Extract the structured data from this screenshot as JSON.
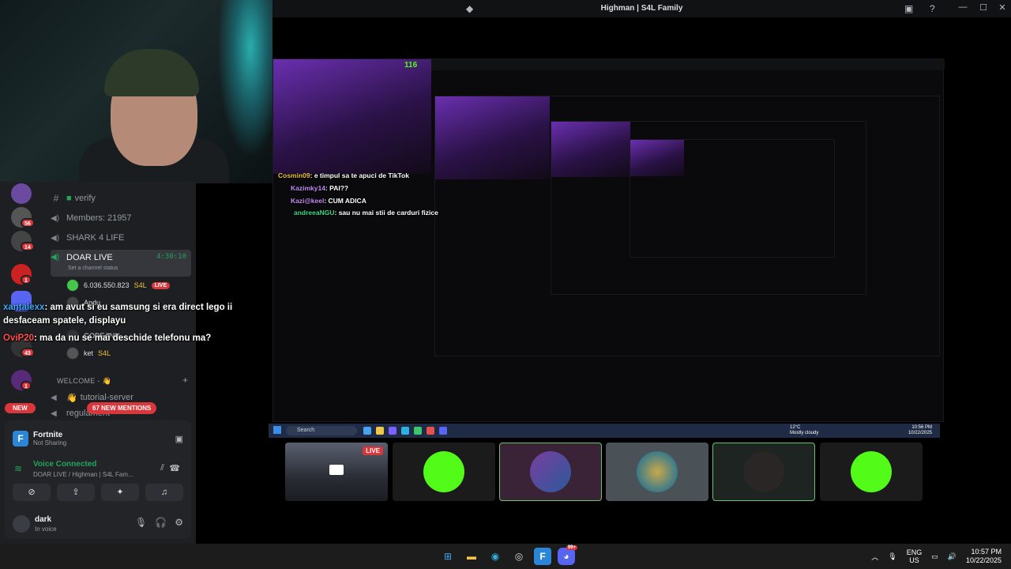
{
  "window": {
    "title": "Highman | S4L Family"
  },
  "discord": {
    "servers": [
      {
        "badge": ""
      },
      {
        "badge": "56"
      },
      {
        "badge": "14"
      },
      {
        "badge": "1"
      },
      {
        "badge": ""
      },
      {
        "badge": "43"
      },
      {
        "badge": "1"
      }
    ],
    "channels": {
      "verify": "verify",
      "members": "Members: 21957",
      "shark": "SHARK 4 LIFE",
      "doar_live": "DOAR LIVE",
      "doar_live_timer": "4:30:10",
      "set_status": "Set a channel status",
      "tutorial": "tutorial-server",
      "regulament": "regulament"
    },
    "voice_members": [
      {
        "name": "6.036.550.823",
        "tag": "S4L",
        "live": "LIVE"
      },
      {
        "name": "Andu",
        "tag": "",
        "live": ""
      },
      {
        "name": "GODEANU",
        "tag": "",
        "live": ""
      },
      {
        "name": "ket",
        "tag": "S4L",
        "live": ""
      }
    ],
    "category_welcome": "WELCOME - 👋",
    "new_pill": "NEW",
    "mentions_pill": "67 NEW MENTIONS",
    "activity": {
      "title": "Fortnite",
      "subtitle": "Not Sharing"
    },
    "voice": {
      "status": "Voice Connected",
      "channel": "DOAR LIVE / Highman | S4L Fam..."
    },
    "user": {
      "name": "dark",
      "status": "In voice"
    }
  },
  "chat": [
    {
      "user": "xantalexx",
      "text": "am avut si eu samsung si era direct lego ii"
    },
    {
      "user": "",
      "text": "desfaceam spatele, displayu"
    },
    {
      "user": "OviP20",
      "text": "ma da nu se mai deschide telefonu ma?"
    }
  ],
  "inner_stream": {
    "kick_count": "116",
    "chat": [
      {
        "user": "Cosmin09",
        "text": "e timpul sa te apuci de TikTok"
      },
      {
        "user": "Kazimky14",
        "text": "PAI??"
      },
      {
        "user": "Kazi@keel",
        "text": "CUM ADICA"
      },
      {
        "user": "andreeaNGU",
        "text": "sau nu mai stii de carduri fizice"
      }
    ]
  },
  "tiles": [
    {
      "label": "",
      "live": "LIVE",
      "color": "#2a2a2e"
    },
    {
      "label": "KICK",
      "live": "",
      "color": "#1b1b1b"
    },
    {
      "label": "",
      "live": "",
      "color": "#3a2336"
    },
    {
      "label": "",
      "live": "",
      "color": "#4a5258"
    },
    {
      "label": "",
      "live": "",
      "color": "#1e2421"
    },
    {
      "label": "",
      "live": "",
      "color": "#1b1b1b"
    }
  ],
  "inner_taskbar": {
    "search": "Search",
    "weather_temp": "12°C",
    "weather_desc": "Mostly cloudy",
    "time": "10:56 PM",
    "date": "10/22/2025"
  },
  "taskbar": {
    "discord_badge": "99+",
    "lang": "ENG",
    "region": "US",
    "time": "10:57 PM",
    "date": "10/22/2025"
  },
  "colors": {
    "discord_bg": "#1e1f22",
    "accent_green": "#23a55a",
    "live_red": "#da373c",
    "kick_green": "#53fc18"
  }
}
